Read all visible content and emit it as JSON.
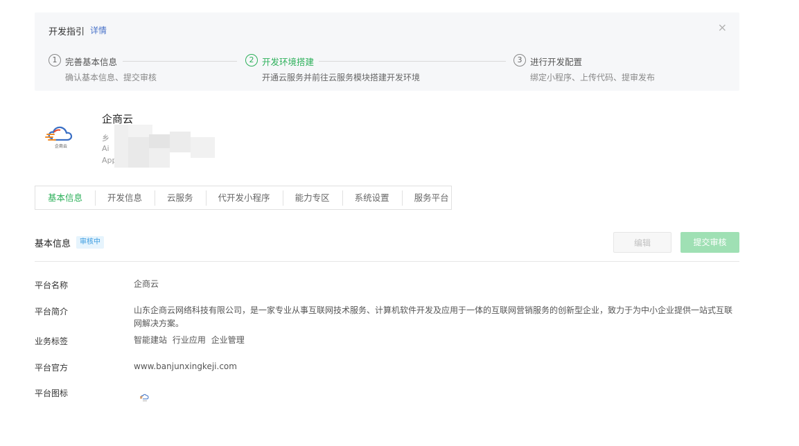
{
  "guide": {
    "title": "开发指引",
    "link": "详情",
    "close_glyph": "×",
    "steps": [
      {
        "num": "1",
        "title": "完善基本信息",
        "desc": "确认基本信息、提交审核"
      },
      {
        "num": "2",
        "title": "开发环境搭建",
        "desc": "开通云服务并前往云服务模块搭建开发环境"
      },
      {
        "num": "3",
        "title": "进行开发配置",
        "desc": "绑定小程序、上传代码、提审发布"
      }
    ]
  },
  "app": {
    "name": "企商云",
    "logo_text": "企商云",
    "meta_lines": [
      "乡",
      "Ai",
      "App"
    ]
  },
  "tabs": [
    "基本信息",
    "开发信息",
    "云服务",
    "代开发小程序",
    "能力专区",
    "系统设置",
    "服务平台"
  ],
  "section": {
    "title": "基本信息",
    "badge": "审核中",
    "edit_label": "编辑",
    "submit_label": "提交审核"
  },
  "info": {
    "name_label": "平台名称",
    "name_value": "企商云",
    "intro_label": "平台简介",
    "intro_value": "山东企商云网络科技有限公司，是一家专业从事互联网技术服务、计算机软件开发及应用于一体的互联网营销服务的创新型企业，致力于为中小企业提供一站式互联网解决方案。",
    "tags_label": "业务标签",
    "tags": [
      "智能建站",
      "行业应用",
      "企业管理"
    ],
    "site_label": "平台官方",
    "site_value": "www.banjunxingkeji.com",
    "icon_label": "平台图标"
  },
  "colors": {
    "accent": "#2db05a",
    "link": "#4a73c9",
    "badge": "#3a9be0"
  }
}
